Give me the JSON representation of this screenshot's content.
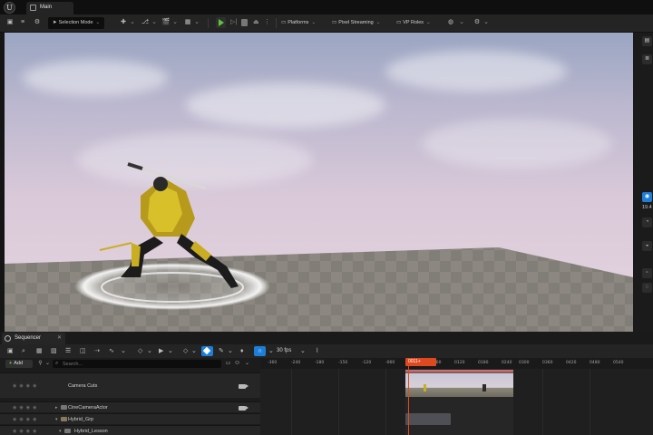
{
  "window": {
    "tab_label": "Main"
  },
  "toolbar": {
    "selection_mode": "Selection Mode",
    "platforms": "Platforms",
    "pixel_streaming": "Pixel Streaming",
    "vp_roles": "VP Roles"
  },
  "viewport": {
    "side_value": "19.4"
  },
  "sequencer": {
    "tab_label": "Sequencer",
    "add_label": "Add",
    "search_placeholder": "Search...",
    "fps_label": "30 fps",
    "playhead_frame": "0011+",
    "tracks": [
      {
        "label": "Camera Cuts"
      },
      {
        "label": "CineCameraActor"
      },
      {
        "label": "Hybrid_Grp"
      },
      {
        "label": "Hybrid_Lesson"
      }
    ],
    "ruler_ticks": [
      "-360",
      "-240",
      "-180",
      "-150",
      "-120",
      "-060",
      "0000",
      "0060",
      "0120",
      "0180",
      "0240",
      "0300",
      "0360",
      "0420",
      "0480",
      "0540"
    ]
  },
  "colors": {
    "accent": "#1e7fd8",
    "playhead": "#e0491f",
    "play_green": "#5ec53a"
  }
}
